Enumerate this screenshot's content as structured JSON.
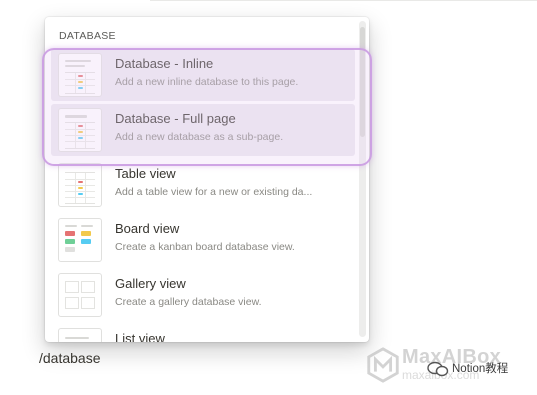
{
  "menu": {
    "section_label": "DATABASE",
    "items": [
      {
        "title": "Database - Inline",
        "description": "Add a new inline database to this page.",
        "icon": "inline-database-thumbnail"
      },
      {
        "title": "Database - Full page",
        "description": "Add a new database as a sub-page.",
        "icon": "full-page-database-thumbnail"
      },
      {
        "title": "Table view",
        "description": "Add a table view for a new or existing da...",
        "icon": "table-view-thumbnail"
      },
      {
        "title": "Board view",
        "description": "Create a kanban board database view.",
        "icon": "board-view-thumbnail"
      },
      {
        "title": "Gallery view",
        "description": "Create a gallery database view.",
        "icon": "gallery-view-thumbnail"
      },
      {
        "title": "List view",
        "description": "",
        "icon": "list-view-thumbnail"
      }
    ]
  },
  "command_text": "/database",
  "watermark": {
    "brand": "MaxAIBox",
    "url": "maxaibox.com",
    "wechat_label": "Notion教程"
  },
  "colors": {
    "highlight_border": "#c896e1",
    "hover_background": "#ebe8f0",
    "tag_red": "#e57373",
    "tag_yellow": "#f2c94c",
    "tag_green": "#6fcf97",
    "tag_blue": "#56ccf2"
  }
}
